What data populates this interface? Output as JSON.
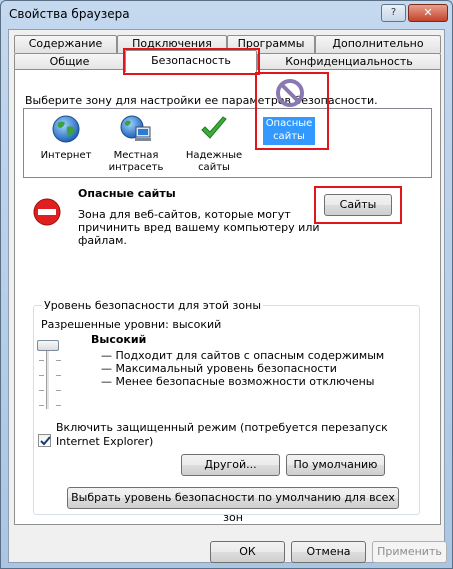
{
  "window": {
    "title": "Свойства браузера",
    "help_glyph": "?",
    "close_glyph": "✕"
  },
  "tabs": {
    "row_back": [
      "Содержание",
      "Подключения",
      "Программы",
      "Дополнительно"
    ],
    "row_front": [
      "Общие",
      "Безопасность",
      "Конфиденциальность"
    ],
    "active": "Безопасность"
  },
  "security": {
    "prompt": "Выберите зону для настройки ее параметров безопасности.",
    "zones": [
      {
        "name": "internet",
        "label_lines": [
          "Интернет"
        ],
        "icon": "globe-icon"
      },
      {
        "name": "local-intranet",
        "label_lines": [
          "Местная",
          "интрасеть"
        ],
        "icon": "intranet-icon"
      },
      {
        "name": "trusted-sites",
        "label_lines": [
          "Надежные",
          "сайты"
        ],
        "icon": "checkmark-icon"
      },
      {
        "name": "restricted-sites",
        "label_lines": [
          "Опасные",
          "сайты"
        ],
        "icon": "restricted-icon",
        "selected": true
      }
    ],
    "zone_title": "Опасные сайты",
    "zone_desc_lines": [
      "Зона для веб-сайтов, которые могут",
      "причинить вред вашему компьютеру или",
      "файлам."
    ],
    "sites_button": "Сайты",
    "level_group_title": "Уровень безопасности для этой зоны",
    "allowed_levels": "Разрешенные уровни: высокий",
    "level_name": "Высокий",
    "level_details": [
      "— Подходит для сайтов с опасным содержимым",
      "— Максимальный уровень безопасности",
      "— Менее безопасные возможности отключены"
    ],
    "protected_mode_lines": [
      "Включить защищенный режим (потребуется перезапуск",
      "Internet Explorer)"
    ],
    "protected_mode_checked": true,
    "custom_button": "Другой...",
    "default_button": "По умолчанию",
    "reset_all_button": "Выбрать уровень безопасности по умолчанию для всех зон"
  },
  "footer": {
    "ok": "ОК",
    "cancel": "Отмена",
    "apply": "Применить"
  },
  "colors": {
    "selection": "#3399ff",
    "highlight": "#e0161b",
    "restricted": "#8a78b2"
  }
}
